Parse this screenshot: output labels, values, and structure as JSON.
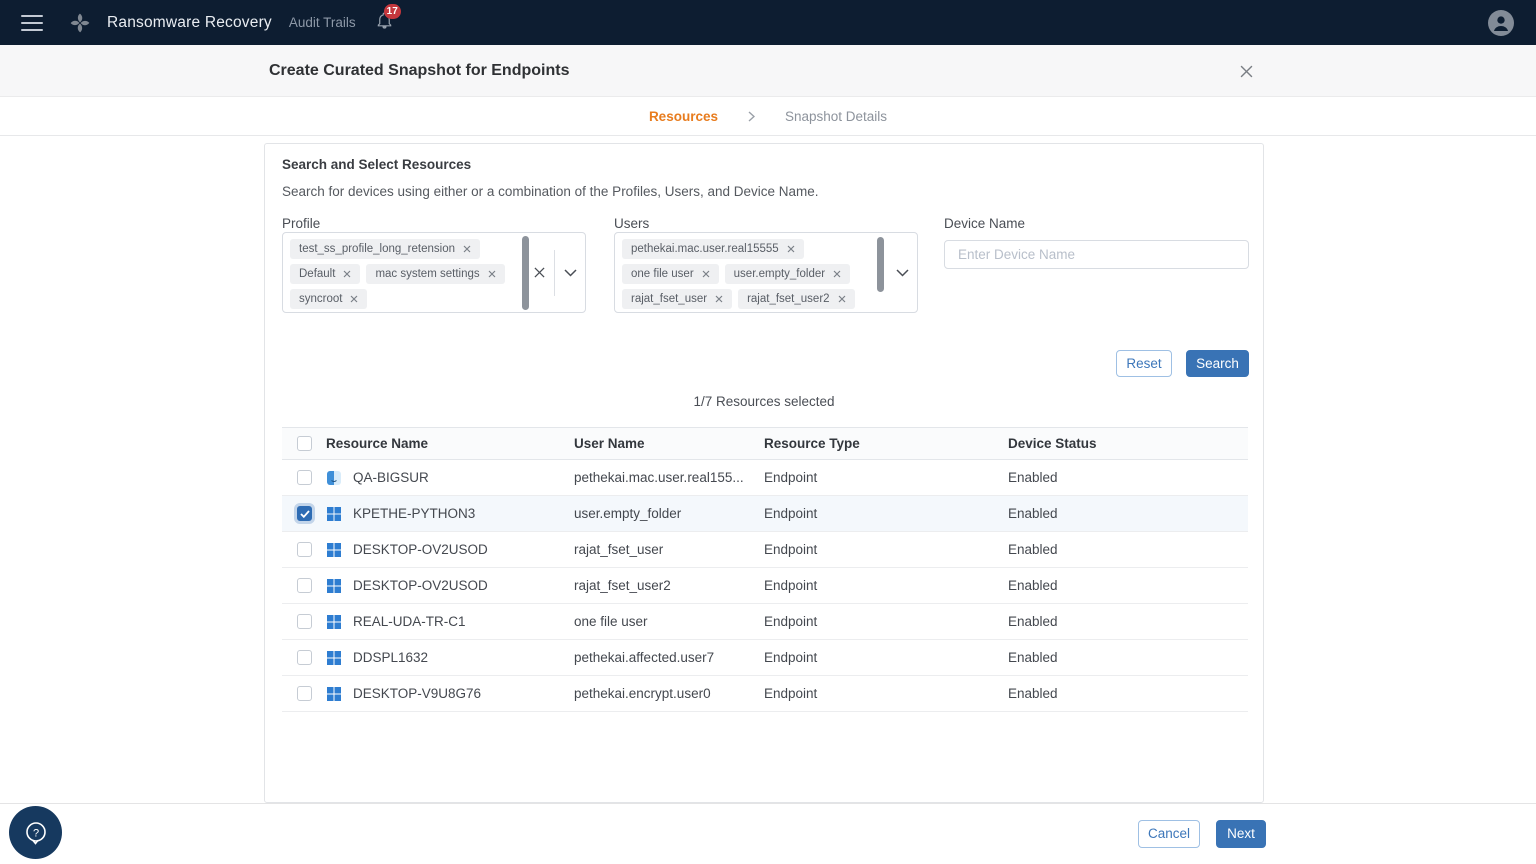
{
  "navbar": {
    "app_title": "Ransomware Recovery",
    "nav_item": "Audit Trails",
    "notification_count": "17"
  },
  "dialog": {
    "title": "Create Curated Snapshot for Endpoints"
  },
  "stepper": {
    "steps": [
      {
        "label": "Resources",
        "active": true
      },
      {
        "label": "Snapshot Details",
        "active": false
      }
    ]
  },
  "search_section": {
    "heading": "Search and Select Resources",
    "description": "Search for devices using either or a combination of the Profiles, Users, and Device Name.",
    "profile": {
      "label": "Profile",
      "chips": [
        "test_ss_profile_long_retension",
        "Default",
        "mac system settings",
        "syncroot"
      ]
    },
    "users": {
      "label": "Users",
      "chips": [
        "pethekai.mac.user.real15555",
        "one file user",
        "user.empty_folder",
        "rajat_fset_user",
        "rajat_fset_user2"
      ]
    },
    "device_name": {
      "label": "Device Name",
      "placeholder": "Enter Device Name"
    },
    "reset_label": "Reset",
    "search_label": "Search"
  },
  "selection_summary": "1/7 Resources selected",
  "table": {
    "headers": {
      "resource_name": "Resource Name",
      "user_name": "User Name",
      "resource_type": "Resource Type",
      "device_status": "Device Status"
    },
    "rows": [
      {
        "resource_name": "QA-BIGSUR",
        "user_name": "pethekai.mac.user.real155...",
        "resource_type": "Endpoint",
        "device_status": "Enabled",
        "os": "mac",
        "checked": false
      },
      {
        "resource_name": "KPETHE-PYTHON3",
        "user_name": "user.empty_folder",
        "resource_type": "Endpoint",
        "device_status": "Enabled",
        "os": "windows",
        "checked": true
      },
      {
        "resource_name": "DESKTOP-OV2USOD",
        "user_name": "rajat_fset_user",
        "resource_type": "Endpoint",
        "device_status": "Enabled",
        "os": "windows",
        "checked": false
      },
      {
        "resource_name": "DESKTOP-OV2USOD",
        "user_name": "rajat_fset_user2",
        "resource_type": "Endpoint",
        "device_status": "Enabled",
        "os": "windows",
        "checked": false
      },
      {
        "resource_name": "REAL-UDA-TR-C1",
        "user_name": "one file user",
        "resource_type": "Endpoint",
        "device_status": "Enabled",
        "os": "windows",
        "checked": false
      },
      {
        "resource_name": "DDSPL1632",
        "user_name": "pethekai.affected.user7",
        "resource_type": "Endpoint",
        "device_status": "Enabled",
        "os": "windows",
        "checked": false
      },
      {
        "resource_name": "DESKTOP-V9U8G76",
        "user_name": "pethekai.encrypt.user0",
        "resource_type": "Endpoint",
        "device_status": "Enabled",
        "os": "windows",
        "checked": false
      }
    ]
  },
  "footer": {
    "cancel_label": "Cancel",
    "next_label": "Next"
  },
  "colors": {
    "navbar_bg": "#0d1d31",
    "accent_orange": "#e87c1e",
    "primary_blue": "#3973b5",
    "badge_red": "#c4373d",
    "selected_row_bg": "#f4f8fc",
    "windows_icon_blue": "#2e7dd1",
    "help_fab_bg": "#16395f"
  }
}
